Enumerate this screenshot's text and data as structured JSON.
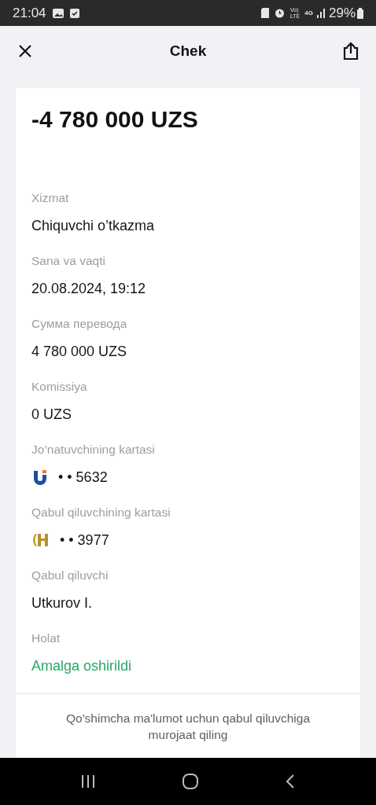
{
  "status_bar": {
    "time": "21:04",
    "volte": [
      "Vo)",
      "LTE"
    ],
    "network": "4G",
    "battery": "29%"
  },
  "header": {
    "title": "Chek"
  },
  "amount": "-4 780 000 UZS",
  "fields": [
    {
      "kind": "text",
      "label": "Xizmat",
      "value": "Chiquvchi o’tkazma"
    },
    {
      "kind": "text",
      "label": "Sana va vaqti",
      "value": "20.08.2024, 19:12"
    },
    {
      "kind": "text",
      "label": "Сумма перевода",
      "value": "4 780 000 UZS"
    },
    {
      "kind": "text",
      "label": "Komissiya",
      "value": "0 UZS"
    },
    {
      "kind": "card",
      "logo": {
        "kind": "u"
      },
      "label": "Jo’natuvchining kartasi",
      "value": "• • 5632"
    },
    {
      "kind": "card",
      "logo": {
        "kind": "h"
      },
      "label": "Qabul qiluvchining kartasi",
      "value": "• • 3977"
    },
    {
      "kind": "text",
      "label": "Qabul qiluvchi",
      "value": "Utkurov I."
    },
    {
      "kind": "status",
      "label": "Holat",
      "value": "Amalga oshirildi"
    }
  ],
  "footer_note": "Qo'shimcha ma'lumot uchun qabul qiluvchiga murojaat qiling"
}
